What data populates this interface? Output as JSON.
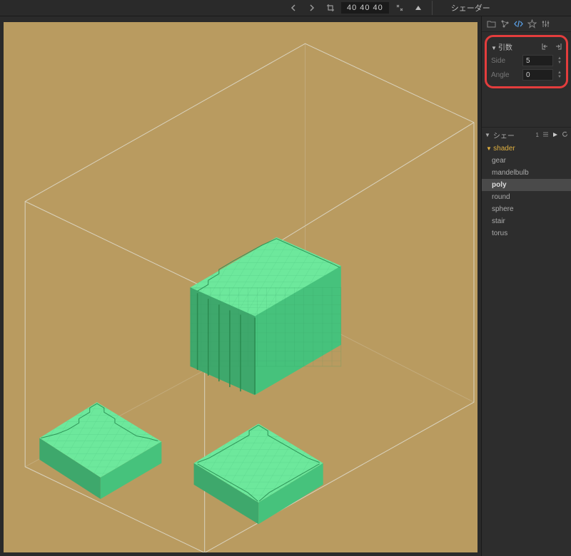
{
  "topbar": {
    "dims": [
      "40",
      "40",
      "40"
    ],
    "panel_title": "シェーダー"
  },
  "icons": {
    "arrow_left": "←",
    "arrow_right": "→",
    "crop": "⧉",
    "expand": "⤡",
    "up": "▲",
    "folder": "folder-icon",
    "graph": "graph-icon",
    "code": "code-icon",
    "star": "star-icon",
    "sliders": "sliders-icon"
  },
  "args_section": {
    "title": "引数",
    "import_icon": "→]",
    "export_icon": "[→",
    "rows": [
      {
        "label": "Side",
        "value": "5"
      },
      {
        "label": "Angle",
        "value": "0"
      }
    ]
  },
  "shaders_section": {
    "title": "シェー",
    "count": "1",
    "stack": "▤",
    "play": "▶",
    "refresh": "↻",
    "header_item": "shader",
    "items": [
      "gear",
      "mandelbulb",
      "poly",
      "round",
      "sphere",
      "stair",
      "torus"
    ],
    "selected": "poly"
  }
}
